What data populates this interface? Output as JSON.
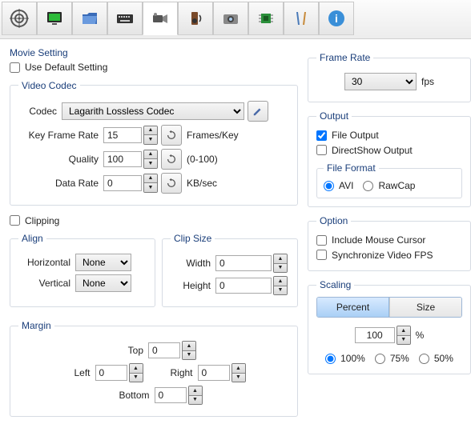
{
  "toolbar": {
    "icons": [
      "target",
      "monitor",
      "folder",
      "keyboard",
      "camcorder",
      "speaker",
      "camera",
      "chip",
      "tools",
      "info"
    ],
    "active_index": 4
  },
  "movie_setting": {
    "title": "Movie Setting",
    "use_default_label": "Use Default Setting",
    "use_default_checked": false
  },
  "video_codec": {
    "legend": "Video Codec",
    "codec_label": "Codec",
    "codec_value": "Lagarith Lossless Codec",
    "key_frame_rate_label": "Key Frame Rate",
    "key_frame_rate_value": "15",
    "key_frame_unit": "Frames/Key",
    "quality_label": "Quality",
    "quality_value": "100",
    "quality_range": "(0-100)",
    "data_rate_label": "Data Rate",
    "data_rate_value": "0",
    "data_rate_unit": "KB/sec"
  },
  "clipping": {
    "label": "Clipping",
    "checked": false,
    "align_legend": "Align",
    "horizontal_label": "Horizontal",
    "horizontal_value": "None",
    "vertical_label": "Vertical",
    "vertical_value": "None",
    "clipsize_legend": "Clip Size",
    "width_label": "Width",
    "width_value": "0",
    "height_label": "Height",
    "height_value": "0",
    "margin_legend": "Margin",
    "top_label": "Top",
    "top_value": "0",
    "left_label": "Left",
    "left_value": "0",
    "right_label": "Right",
    "right_value": "0",
    "bottom_label": "Bottom",
    "bottom_value": "0"
  },
  "frame_rate": {
    "legend": "Frame Rate",
    "value": "30",
    "unit": "fps"
  },
  "output": {
    "legend": "Output",
    "file_output_label": "File Output",
    "file_output_checked": true,
    "directshow_label": "DirectShow Output",
    "directshow_checked": false,
    "file_format_legend": "File Format",
    "avi_label": "AVI",
    "rawcap_label": "RawCap",
    "format_selected": "avi"
  },
  "option": {
    "legend": "Option",
    "mouse_label": "Include Mouse Cursor",
    "mouse_checked": false,
    "sync_label": "Synchronize Video FPS",
    "sync_checked": false
  },
  "scaling": {
    "legend": "Scaling",
    "percent_tab": "Percent",
    "size_tab": "Size",
    "mode": "percent",
    "value": "100",
    "unit": "%",
    "opt100": "100%",
    "opt75": "75%",
    "opt50": "50%",
    "radio_selected": "100"
  }
}
